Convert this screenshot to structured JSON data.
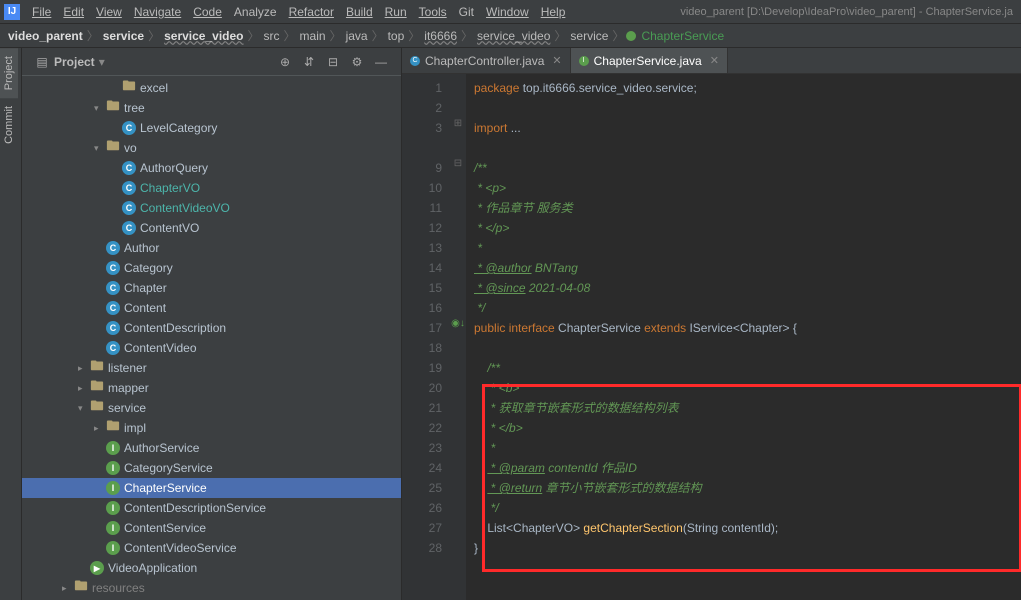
{
  "window": {
    "title": "video_parent [D:\\Develop\\IdeaPro\\video_parent] - ChapterService.ja"
  },
  "menu": {
    "items": [
      "File",
      "Edit",
      "View",
      "Navigate",
      "Code",
      "Analyze",
      "Refactor",
      "Build",
      "Run",
      "Tools",
      "Git",
      "Window",
      "Help"
    ]
  },
  "breadcrumbs": {
    "parts": [
      "video_parent",
      "service",
      "service_video",
      "src",
      "main",
      "java",
      "top",
      "it6666",
      "service_video",
      "service"
    ],
    "leaf": "ChapterService",
    "leaf_icon": "interface"
  },
  "left_tabs": {
    "project": "Project",
    "commit": "Commit"
  },
  "project_panel": {
    "title": "Project",
    "tree": [
      {
        "d": 5,
        "chev": "",
        "icon": "folder",
        "label": "excel",
        "cls": ""
      },
      {
        "d": 4,
        "chev": "v",
        "icon": "folder",
        "label": "tree",
        "cls": ""
      },
      {
        "d": 5,
        "chev": "",
        "icon": "cls-c",
        "label": "LevelCategory",
        "cls": ""
      },
      {
        "d": 4,
        "chev": "v",
        "icon": "folder",
        "label": "vo",
        "cls": ""
      },
      {
        "d": 5,
        "chev": "",
        "icon": "cls-c",
        "label": "AuthorQuery",
        "cls": ""
      },
      {
        "d": 5,
        "chev": "",
        "icon": "cls-c",
        "label": "ChapterVO",
        "cls": "teal"
      },
      {
        "d": 5,
        "chev": "",
        "icon": "cls-c",
        "label": "ContentVideoVO",
        "cls": "teal"
      },
      {
        "d": 5,
        "chev": "",
        "icon": "cls-c",
        "label": "ContentVO",
        "cls": ""
      },
      {
        "d": 4,
        "chev": "",
        "icon": "cls-c",
        "label": "Author",
        "cls": ""
      },
      {
        "d": 4,
        "chev": "",
        "icon": "cls-c",
        "label": "Category",
        "cls": ""
      },
      {
        "d": 4,
        "chev": "",
        "icon": "cls-c",
        "label": "Chapter",
        "cls": ""
      },
      {
        "d": 4,
        "chev": "",
        "icon": "cls-c",
        "label": "Content",
        "cls": ""
      },
      {
        "d": 4,
        "chev": "",
        "icon": "cls-c",
        "label": "ContentDescription",
        "cls": ""
      },
      {
        "d": 4,
        "chev": "",
        "icon": "cls-c",
        "label": "ContentVideo",
        "cls": ""
      },
      {
        "d": 3,
        "chev": ">",
        "icon": "folder",
        "label": "listener",
        "cls": ""
      },
      {
        "d": 3,
        "chev": ">",
        "icon": "folder",
        "label": "mapper",
        "cls": ""
      },
      {
        "d": 3,
        "chev": "v",
        "icon": "folder",
        "label": "service",
        "cls": ""
      },
      {
        "d": 4,
        "chev": ">",
        "icon": "folder",
        "label": "impl",
        "cls": ""
      },
      {
        "d": 4,
        "chev": "",
        "icon": "cls-i",
        "label": "AuthorService",
        "cls": ""
      },
      {
        "d": 4,
        "chev": "",
        "icon": "cls-i",
        "label": "CategoryService",
        "cls": ""
      },
      {
        "d": 4,
        "chev": "",
        "icon": "cls-i",
        "label": "ChapterService",
        "cls": "",
        "sel": true
      },
      {
        "d": 4,
        "chev": "",
        "icon": "cls-i",
        "label": "ContentDescriptionService",
        "cls": ""
      },
      {
        "d": 4,
        "chev": "",
        "icon": "cls-i",
        "label": "ContentService",
        "cls": ""
      },
      {
        "d": 4,
        "chev": "",
        "icon": "cls-i",
        "label": "ContentVideoService",
        "cls": ""
      },
      {
        "d": 3,
        "chev": "",
        "icon": "cls-s",
        "label": "VideoApplication",
        "cls": ""
      },
      {
        "d": 2,
        "chev": ">",
        "icon": "folder",
        "label": "resources",
        "cls": "dim"
      }
    ]
  },
  "editor_tabs": [
    {
      "label": "ChapterController.java",
      "icon": "c",
      "active": false
    },
    {
      "label": "ChapterService.java",
      "icon": "i",
      "active": true
    }
  ],
  "code": {
    "line_numbers": [
      "1",
      "2",
      "3",
      "",
      "9",
      "10",
      "11",
      "12",
      "13",
      "14",
      "15",
      "16",
      "17",
      "18",
      "19",
      "20",
      "21",
      "22",
      "23",
      "24",
      "25",
      "26",
      "27",
      "28"
    ],
    "lines": {
      "l1_pkg": "package ",
      "l1_path": "top.it6666.service_video.service",
      "l1_end": ";",
      "l3_imp": "import ",
      "l3_dots": "...",
      "c_open": "/**",
      "c_p_o": " * <p>",
      "c_desc": " * 作品章节 服务类",
      "c_p_c": " * </p>",
      "c_star": " *",
      "c_auth_t": " * @author",
      "c_auth_v": " BNTang",
      "c_since_t": " * @since",
      "c_since_v": " 2021-04-08",
      "c_close": " */",
      "sig_pub": "public interface ",
      "sig_name": "ChapterService",
      "sig_ext": " extends ",
      "sig_parent": "IService",
      "sig_gen_o": "<",
      "sig_gen_ty": "Chapter",
      "sig_gen_c": "> {",
      "m_c_open": "/**",
      "m_b_o": " * <b>",
      "m_desc": " * 获取章节嵌套形式的数据结构列表",
      "m_b_c": " * </b>",
      "m_star": " *",
      "m_param_t": " * @param",
      "m_param_v": " contentId 作品ID",
      "m_ret_t": " * @return",
      "m_ret_v": " 章节小节嵌套形式的数据结构",
      "m_c_close": " */",
      "m_sig_ret": "List",
      "m_sig_gen": "<ChapterVO> ",
      "m_sig_fn": "getChapterSection",
      "m_sig_args": "(String contentId);",
      "brace_c": "}"
    }
  }
}
